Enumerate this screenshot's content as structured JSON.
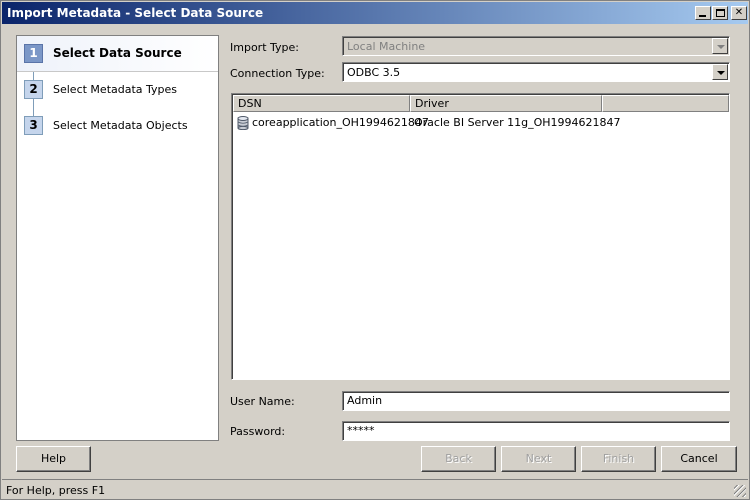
{
  "window": {
    "title": "Import Metadata - Select Data Source"
  },
  "steps": [
    {
      "number": "1",
      "label": "Select Data Source",
      "active": true
    },
    {
      "number": "2",
      "label": "Select Metadata Types",
      "active": false
    },
    {
      "number": "3",
      "label": "Select Metadata Objects",
      "active": false
    }
  ],
  "form": {
    "import_type_label": "Import Type:",
    "import_type_value": "Local Machine",
    "connection_type_label": "Connection Type:",
    "connection_type_value": "ODBC 3.5",
    "user_name_label": "User Name:",
    "user_name_value": "Admin",
    "password_label": "Password:",
    "password_value": "*****"
  },
  "dsn_table": {
    "columns": [
      "DSN",
      "Driver"
    ],
    "rows": [
      {
        "dsn": "coreapplication_OH1994621847",
        "driver": "Oracle BI Server 11g_OH1994621847",
        "icon": "database-icon"
      }
    ]
  },
  "buttons": {
    "help": "Help",
    "back": "Back",
    "next": "Next",
    "finish": "Finish",
    "cancel": "Cancel"
  },
  "status": {
    "text": "For Help, press F1"
  },
  "colors": {
    "title_start": "#0a246a",
    "title_end": "#a6caf0",
    "face": "#d4d0c8",
    "active_step": "#7b97c7"
  }
}
